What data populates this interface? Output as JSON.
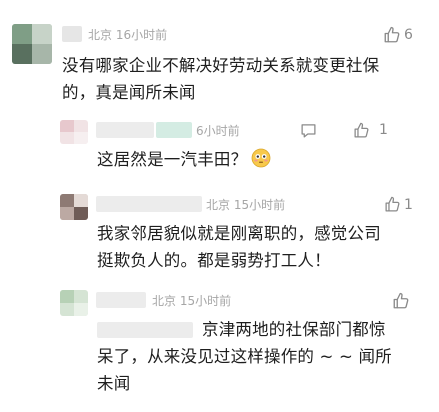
{
  "comments": [
    {
      "location": "北京",
      "time": "16小时前",
      "text_line1": "没有哪家企业不解决好劳动关系就变更社保",
      "text_line2": "的，真是闻所未闻",
      "likes": "6",
      "icon": "thumbs-up-icon"
    },
    {
      "time_partial": "6小时前",
      "text": "这居然是一汽丰田？",
      "emoji": "flushed-face-emoji",
      "likes": "1",
      "icons": [
        "reply-icon",
        "thumbs-up-icon"
      ]
    },
    {
      "location_partial": "北京",
      "time": "15小时前",
      "text_line1": "我家邻居貌似就是刚离职的，感觉公司",
      "text_line2": "挺欺负人的。都是弱势打工人！",
      "likes": "1",
      "icon": "thumbs-up-icon"
    },
    {
      "location": "北京",
      "time": "15小时前",
      "text_line1": "京津两地的社保部门都惊",
      "text_line2": "呆了，从来没见过这样操作的 ~ ~ 闻所",
      "text_line3": "未闻",
      "likes": "",
      "icon": "thumbs-up-icon"
    }
  ],
  "colors": {
    "text": "#1e1e1e",
    "meta": "#a6a6a6",
    "icon": "#8a8a8a"
  }
}
